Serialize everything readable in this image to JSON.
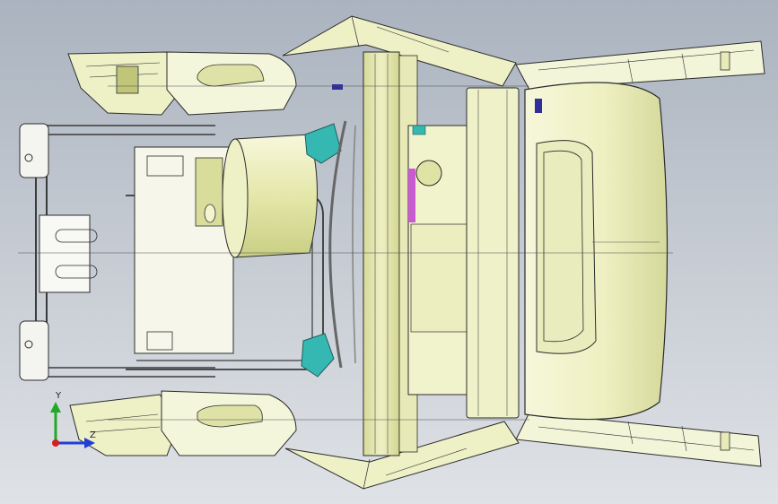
{
  "viewport": {
    "background_top": "#aab3bf",
    "background_bottom": "#dfe2e6"
  },
  "model": {
    "colors": {
      "part_fill": "#f3f5cf",
      "part_shade": "#d9dd9c",
      "part_dark": "#b9c072",
      "edge": "#2b2b2b",
      "frame_fill": "#ffffff",
      "teal_clip": "#35b8b1",
      "magenta_part": "#c95ad0",
      "blue_part": "#2f2f9a"
    }
  },
  "triad": {
    "y_label": "Y",
    "z_label": "Z",
    "y_color": "#22a82a",
    "x_color": "#1f3fd6",
    "origin_color": "#d42020"
  }
}
